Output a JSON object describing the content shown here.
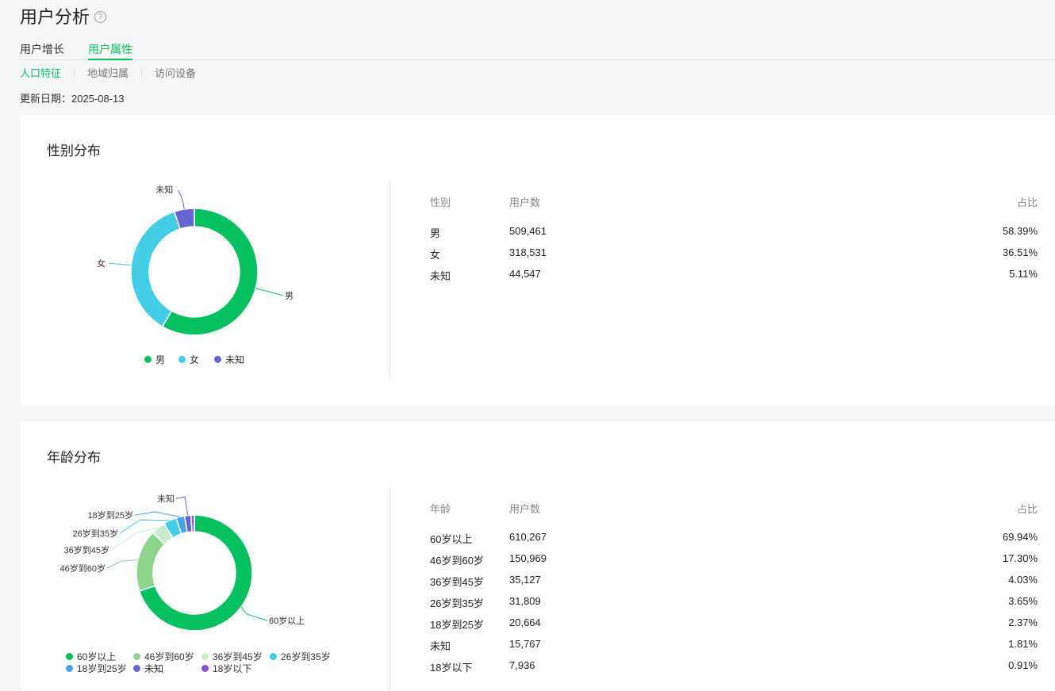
{
  "header": {
    "title": "用户分析",
    "help_icon": "?"
  },
  "tabs": [
    {
      "label": "用户增长"
    },
    {
      "label": "用户属性",
      "active": true
    }
  ],
  "subtabs": [
    {
      "label": "人口特征",
      "active": true
    },
    {
      "label": "地域归属"
    },
    {
      "label": "访问设备"
    }
  ],
  "update": {
    "label": "更新日期：",
    "date": "2025-08-13"
  },
  "gender": {
    "title": "性别分布",
    "headers": [
      "性别",
      "用户数",
      "占比"
    ],
    "rows": [
      {
        "name": "男",
        "count": "509,461",
        "pct": "58.39%"
      },
      {
        "name": "女",
        "count": "318,531",
        "pct": "36.51%"
      },
      {
        "name": "未知",
        "count": "44,547",
        "pct": "5.11%"
      }
    ]
  },
  "age": {
    "title": "年龄分布",
    "headers": [
      "年龄",
      "用户数",
      "占比"
    ],
    "rows": [
      {
        "name": "60岁以上",
        "count": "610,267",
        "pct": "69.94%"
      },
      {
        "name": "46岁到60岁",
        "count": "150,969",
        "pct": "17.30%"
      },
      {
        "name": "36岁到45岁",
        "count": "35,127",
        "pct": "4.03%"
      },
      {
        "name": "26岁到35岁",
        "count": "31,809",
        "pct": "3.65%"
      },
      {
        "name": "18岁到25岁",
        "count": "20,664",
        "pct": "2.37%"
      },
      {
        "name": "未知",
        "count": "15,767",
        "pct": "1.81%"
      },
      {
        "name": "18岁以下",
        "count": "7,936",
        "pct": "0.91%"
      }
    ]
  },
  "colors": {
    "accent": "#07c160",
    "gender": [
      "#07c160",
      "#43cde6",
      "#6467cf"
    ],
    "age": [
      "#07c160",
      "#8ed48c",
      "#c9ecd0",
      "#43cde6",
      "#48a2e6",
      "#6467cf",
      "#8d54d2"
    ]
  },
  "chart_data": [
    {
      "type": "pie",
      "title": "性别分布",
      "categories": [
        "男",
        "女",
        "未知"
      ],
      "values": [
        509461,
        318531,
        44547
      ],
      "percentages": [
        58.39,
        36.51,
        5.11
      ],
      "legend": "bottom"
    },
    {
      "type": "pie",
      "title": "年龄分布",
      "categories": [
        "60岁以上",
        "46岁到60岁",
        "36岁到45岁",
        "26岁到35岁",
        "18岁到25岁",
        "未知",
        "18岁以下"
      ],
      "values": [
        610267,
        150969,
        35127,
        31809,
        20664,
        15767,
        7936
      ],
      "percentages": [
        69.94,
        17.3,
        4.03,
        3.65,
        2.37,
        1.81,
        0.91
      ],
      "legend": "bottom"
    }
  ]
}
